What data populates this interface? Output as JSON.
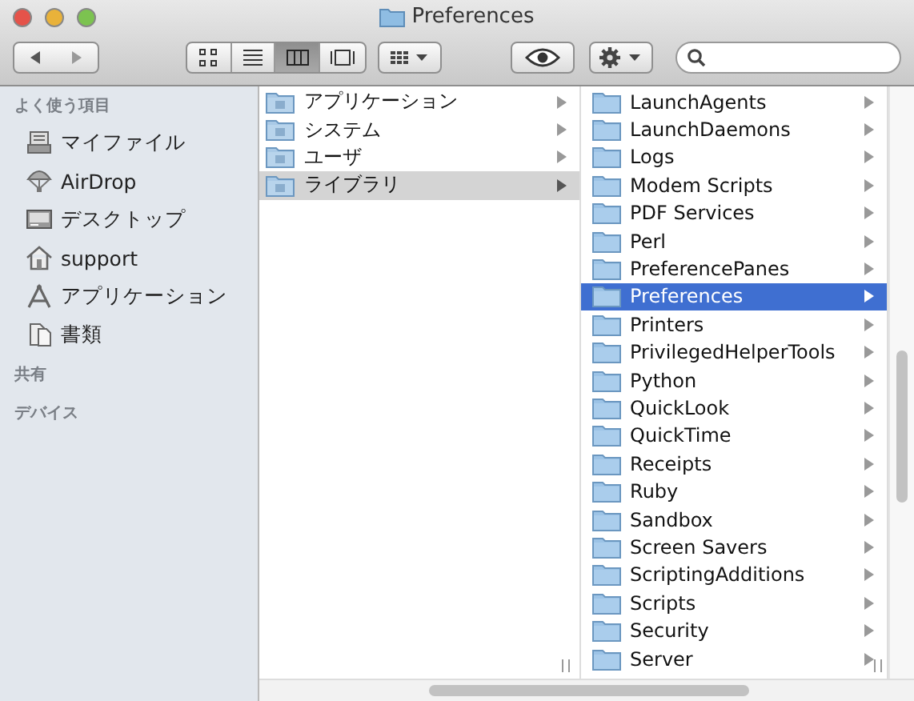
{
  "window": {
    "title": "Preferences"
  },
  "toolbar": {
    "view_buttons": [
      {
        "selected": false
      },
      {
        "selected": false
      },
      {
        "selected": true
      },
      {
        "selected": false
      }
    ]
  },
  "sidebar": {
    "sections": [
      {
        "title": "よく使う項目",
        "items": [
          {
            "label": "マイファイル"
          },
          {
            "label": "AirDrop"
          },
          {
            "label": "デスクトップ"
          },
          {
            "label": "support"
          },
          {
            "label": "アプリケーション"
          },
          {
            "label": "書類"
          }
        ]
      },
      {
        "title": "共有"
      },
      {
        "title": "デバイス"
      }
    ]
  },
  "columns": [
    {
      "items": [
        {
          "label": "アプリケーション",
          "selected": false
        },
        {
          "label": "システム",
          "selected": false
        },
        {
          "label": "ユーザ",
          "selected": false
        },
        {
          "label": "ライブラリ",
          "selected": true
        }
      ]
    },
    {
      "items": [
        {
          "label": "LaunchAgents",
          "selected": false
        },
        {
          "label": "LaunchDaemons",
          "selected": false
        },
        {
          "label": "Logs",
          "selected": false
        },
        {
          "label": "Modem Scripts",
          "selected": false
        },
        {
          "label": "PDF Services",
          "selected": false
        },
        {
          "label": "Perl",
          "selected": false
        },
        {
          "label": "PreferencePanes",
          "selected": false
        },
        {
          "label": "Preferences",
          "selected": true
        },
        {
          "label": "Printers",
          "selected": false
        },
        {
          "label": "PrivilegedHelperTools",
          "selected": false
        },
        {
          "label": "Python",
          "selected": false
        },
        {
          "label": "QuickLook",
          "selected": false
        },
        {
          "label": "QuickTime",
          "selected": false
        },
        {
          "label": "Receipts",
          "selected": false
        },
        {
          "label": "Ruby",
          "selected": false
        },
        {
          "label": "Sandbox",
          "selected": false
        },
        {
          "label": "Screen Savers",
          "selected": false
        },
        {
          "label": "ScriptingAdditions",
          "selected": false
        },
        {
          "label": "Scripts",
          "selected": false
        },
        {
          "label": "Security",
          "selected": false
        },
        {
          "label": "Server",
          "selected": false
        }
      ]
    }
  ]
}
